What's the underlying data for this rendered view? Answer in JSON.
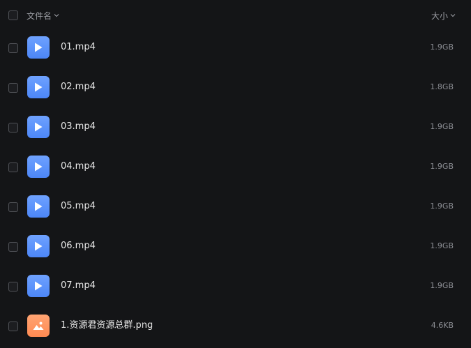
{
  "header": {
    "name_label": "文件名",
    "size_label": "大小"
  },
  "files": [
    {
      "name": "01.mp4",
      "size": "1.9GB",
      "type": "video",
      "icon": "play-icon"
    },
    {
      "name": "02.mp4",
      "size": "1.8GB",
      "type": "video",
      "icon": "play-icon"
    },
    {
      "name": "03.mp4",
      "size": "1.9GB",
      "type": "video",
      "icon": "play-icon"
    },
    {
      "name": "04.mp4",
      "size": "1.9GB",
      "type": "video",
      "icon": "play-icon"
    },
    {
      "name": "05.mp4",
      "size": "1.9GB",
      "type": "video",
      "icon": "play-icon"
    },
    {
      "name": "06.mp4",
      "size": "1.9GB",
      "type": "video",
      "icon": "play-icon"
    },
    {
      "name": "07.mp4",
      "size": "1.9GB",
      "type": "video",
      "icon": "play-icon"
    },
    {
      "name": "1.资源君资源总群.png",
      "size": "4.6KB",
      "type": "image",
      "icon": "image-icon"
    }
  ],
  "colors": {
    "background": "#141517",
    "video_icon": "#5b91fb",
    "image_icon": "#ff9660"
  }
}
